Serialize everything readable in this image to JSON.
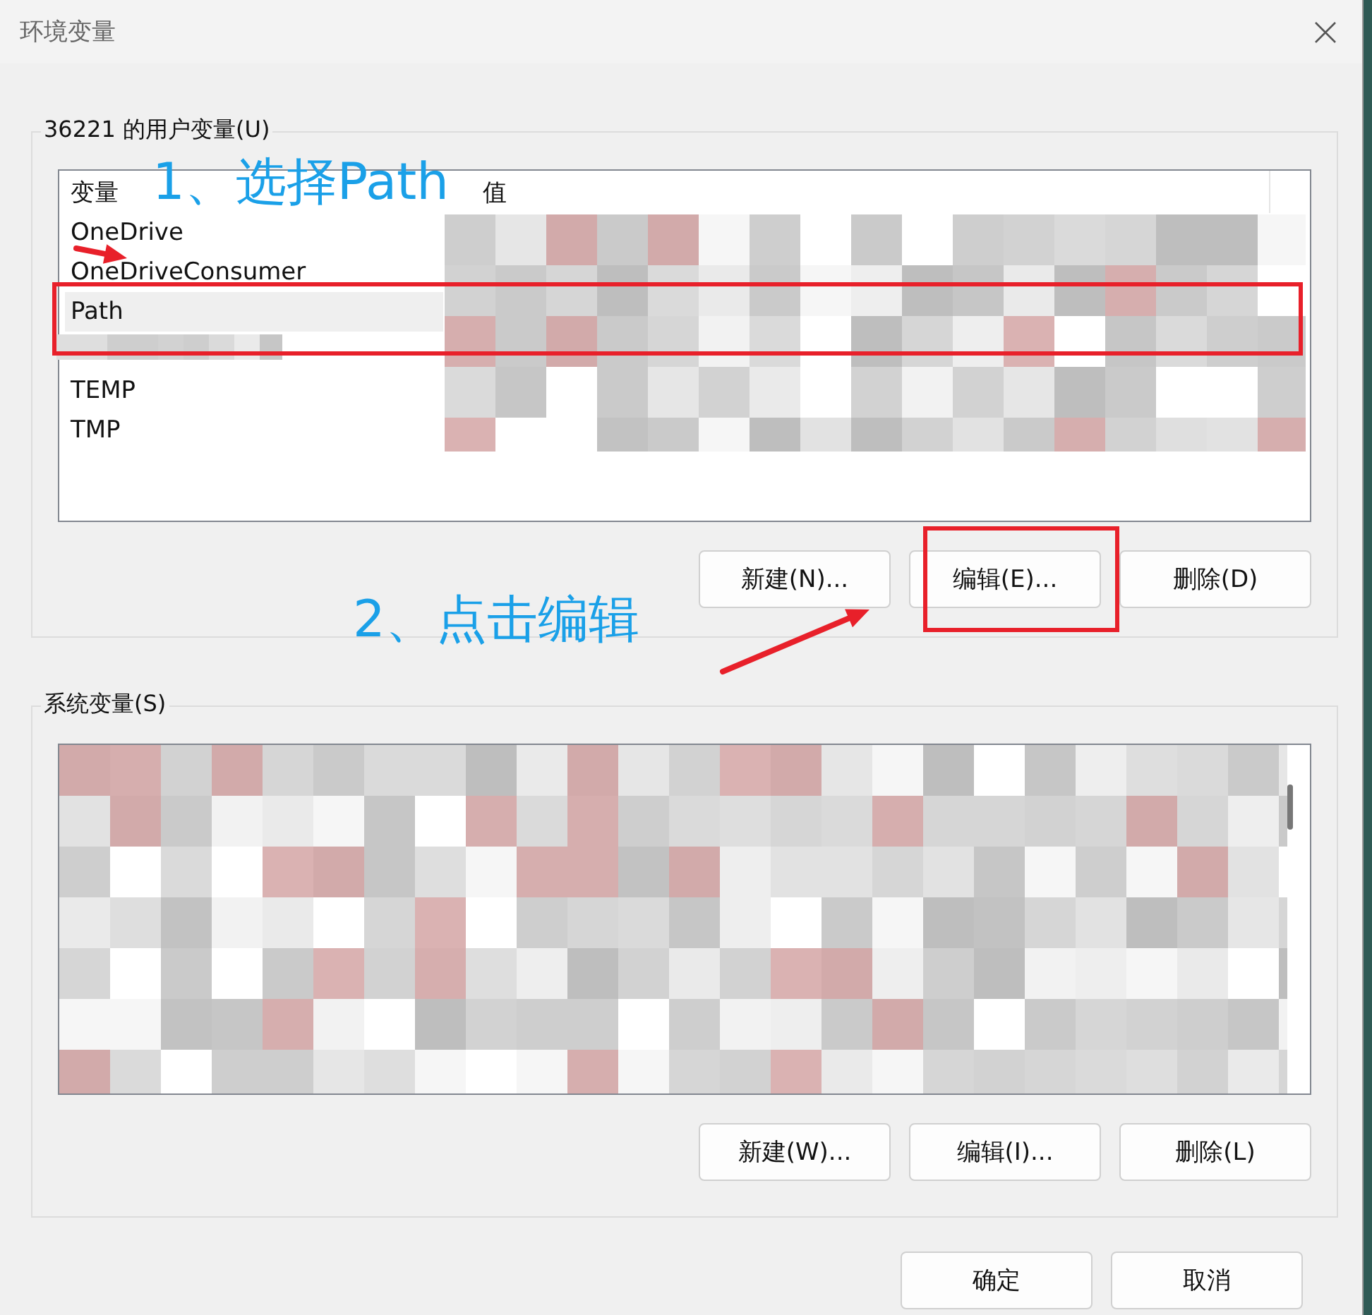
{
  "window": {
    "title": "环境变量"
  },
  "user_variables": {
    "title": "36221 的用户变量(U)",
    "columns": [
      "变量",
      "值"
    ],
    "rows": [
      {
        "kind": "variable",
        "name": "OneDrive",
        "selected": false
      },
      {
        "kind": "variable",
        "name": "OneDriveConsumer",
        "selected": false
      },
      {
        "kind": "variable",
        "name": "Path",
        "selected": true
      },
      {
        "kind": "redacted"
      },
      {
        "kind": "variable",
        "name": "TEMP",
        "selected": false
      },
      {
        "kind": "variable",
        "name": "TMP",
        "selected": false
      }
    ],
    "buttons": [
      "新建(N)...",
      "编辑(E)...",
      "删除(D)"
    ]
  },
  "system_variables": {
    "title": "系统变量(S)",
    "buttons": [
      "新建(W)...",
      "编辑(I)...",
      "删除(L)"
    ]
  },
  "dialog_buttons": [
    "确定",
    "取消"
  ],
  "annotations": [
    {
      "text": "1、选择Path"
    },
    {
      "text": "2、点击编辑"
    }
  ]
}
